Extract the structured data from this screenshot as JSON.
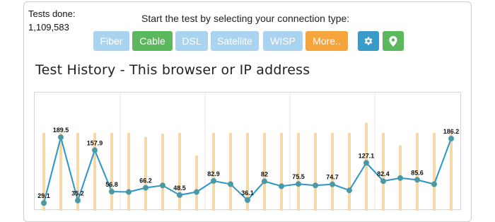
{
  "stats": {
    "tests_done_label": "Tests done:",
    "tests_done_value": "1,109,583"
  },
  "selector": {
    "instruction": "Start the test by selecting your connection type:",
    "buttons": [
      {
        "label": "Fiber",
        "state": "inactive"
      },
      {
        "label": "Cable",
        "state": "selected"
      },
      {
        "label": "DSL",
        "state": "inactive"
      },
      {
        "label": "Satellite",
        "state": "inactive"
      },
      {
        "label": "WISP",
        "state": "inactive"
      },
      {
        "label": "More..",
        "state": "menu"
      }
    ],
    "icon_buttons": [
      {
        "icon": "gear-icon"
      },
      {
        "icon": "map-pin-icon"
      }
    ]
  },
  "history": {
    "title": "Test History - This browser or IP address"
  },
  "colors": {
    "inactive_button": "#a9d3ee",
    "selected_button": "#5cb85c",
    "more_button": "#f5a53c",
    "settings_button": "#3a9bc9",
    "location_button": "#5cb85c",
    "line": "#2b95c6",
    "point": "#4a9aa5",
    "bar": "#f5d9a6"
  },
  "chart_data": {
    "type": "line",
    "title": "",
    "xlabel": "",
    "ylabel": "",
    "ylim": [
      0,
      240
    ],
    "grid": "vertical",
    "series": [
      {
        "values": [
          29.1,
          189.5,
          35.2,
          157.9,
          56.8,
          56,
          66.2,
          72,
          48.5,
          56,
          82.9,
          75,
          36.1,
          82,
          70,
          75.5,
          72,
          74.7,
          60,
          127.1,
          82.4,
          90,
          85.6,
          75,
          186.2
        ],
        "labels": [
          "29.1",
          "189.5",
          "35.2",
          "157.9",
          "56.8",
          "",
          "66.2",
          "",
          "48.5",
          "",
          "82.9",
          "",
          "36.1",
          "82",
          "",
          "75.5",
          "",
          "74.7",
          "",
          "127.1",
          "82.4",
          "",
          "85.6",
          "",
          "186.2"
        ]
      },
      {
        "type": "bar",
        "values": [
          200,
          200,
          200,
          200,
          200,
          200,
          190,
          198,
          200,
          145,
          200,
          200,
          200,
          200,
          200,
          200,
          200,
          200,
          200,
          225,
          200,
          170,
          200,
          200,
          200
        ]
      }
    ]
  }
}
